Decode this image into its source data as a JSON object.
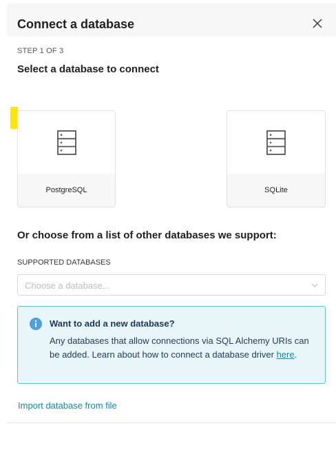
{
  "modal": {
    "title": "Connect a database",
    "step": "STEP 1 OF 3",
    "subtitle": "Select a database to connect",
    "cards": [
      {
        "label": "PostgreSQL",
        "icon": "database-icon"
      },
      {
        "label": "SQLite",
        "icon": "database-icon"
      }
    ],
    "other_heading": "Or choose from a list of other databases we support:",
    "supported_label": "SUPPORTED DATABASES",
    "select_placeholder": "Choose a database...",
    "alert": {
      "title": "Want to add a new database?",
      "body": "Any databases that allow connections via SQL Alchemy URIs can be added. Learn about how to connect a database driver ",
      "link": "here",
      "end": "."
    },
    "import_link": "Import database from file"
  },
  "colors": {
    "accent": "#1a85a0",
    "alert_bg": "#e9f6f9",
    "alert_border": "#66bcd6",
    "highlight": "#ffe600"
  }
}
